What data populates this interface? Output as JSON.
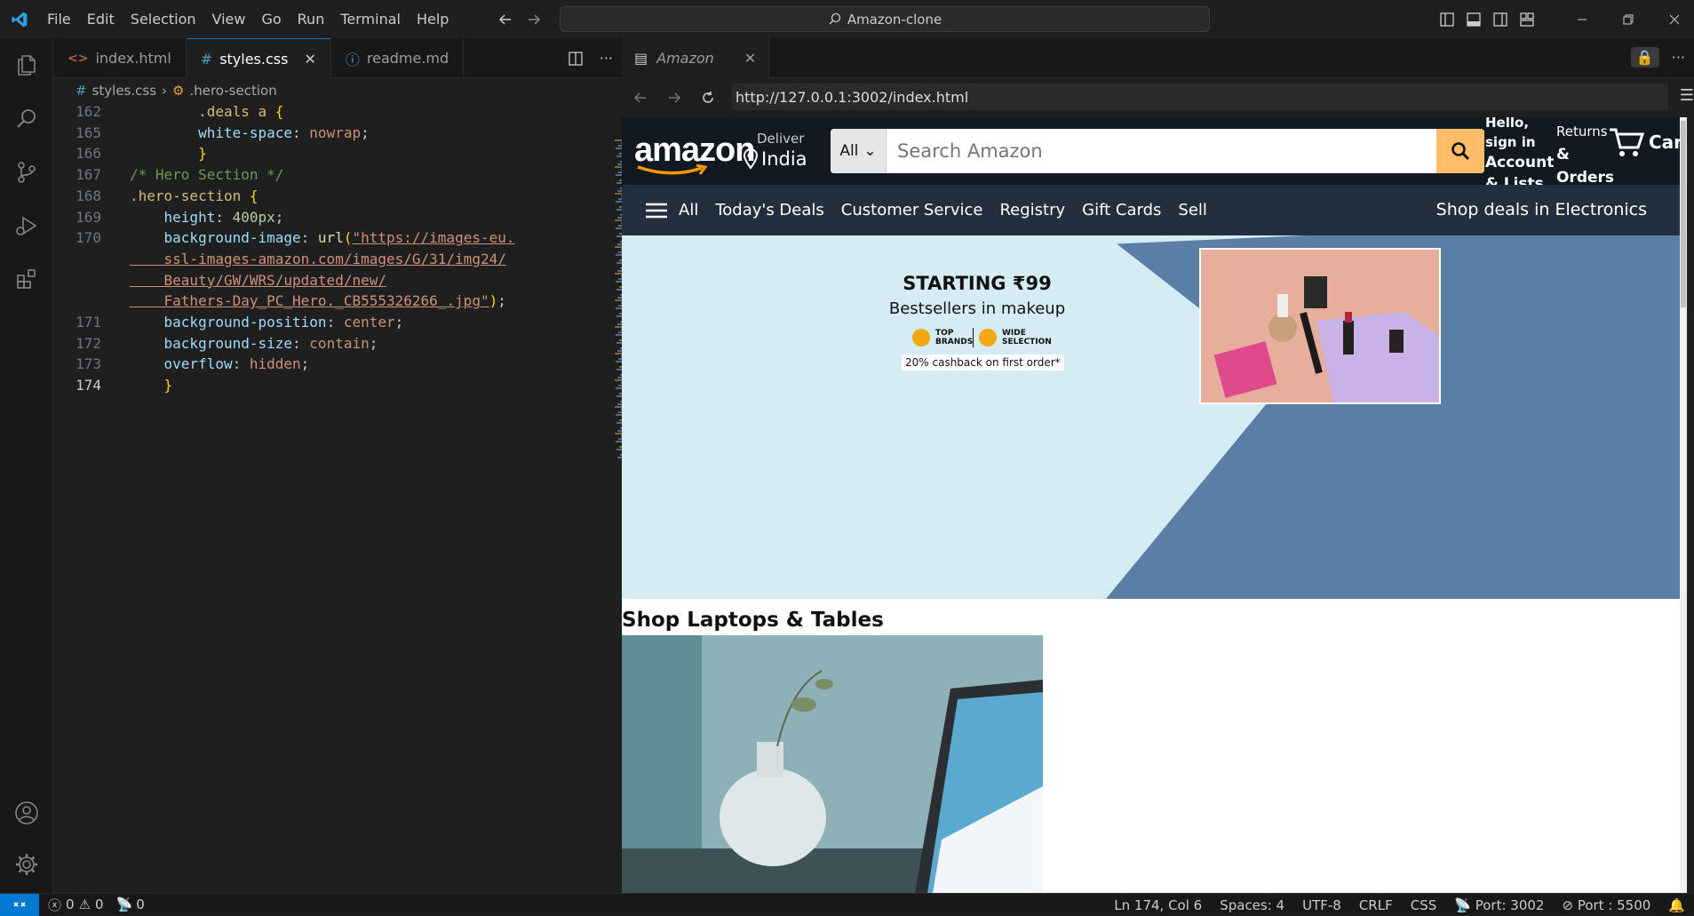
{
  "menu": [
    "File",
    "Edit",
    "Selection",
    "View",
    "Go",
    "Run",
    "Terminal",
    "Help"
  ],
  "search_title": "Amazon-clone",
  "editor": {
    "tabs": [
      {
        "label": "index.html",
        "icon": "html-icon"
      },
      {
        "label": "styles.css",
        "icon": "css-hash-icon"
      },
      {
        "label": "readme.md",
        "icon": "info-icon"
      }
    ],
    "breadcrumb": {
      "file": "styles.css",
      "symbol": ".hero-section"
    },
    "line_numbers": [
      "162",
      "165",
      "166",
      "167",
      "168",
      "169",
      "170",
      "",
      "",
      "",
      "171",
      "172",
      "173",
      "174"
    ],
    "lines": [
      {
        "parts": [
          [
            "sel",
            "        .deals a "
          ],
          [
            "br",
            "{"
          ]
        ]
      },
      {
        "parts": [
          [
            "prop",
            "        white-space"
          ],
          [
            "txt",
            ": "
          ],
          [
            "val",
            "nowrap"
          ],
          [
            "txt",
            ";"
          ]
        ]
      },
      {
        "parts": [
          [
            "br",
            "        }"
          ]
        ]
      },
      {
        "parts": [
          [
            "cmt",
            "/* Hero Section */"
          ]
        ]
      },
      {
        "parts": [
          [
            "sel",
            ".hero-section "
          ],
          [
            "br",
            "{"
          ]
        ]
      },
      {
        "parts": [
          [
            "prop",
            "    height"
          ],
          [
            "txt",
            ": "
          ],
          [
            "num",
            "400px"
          ],
          [
            "txt",
            ";"
          ]
        ]
      },
      {
        "parts": [
          [
            "prop",
            "    background-image"
          ],
          [
            "txt",
            ": "
          ],
          [
            "fn",
            "url"
          ],
          [
            "br",
            "("
          ],
          [
            "url",
            "\"https://images-eu."
          ]
        ]
      },
      {
        "parts": [
          [
            "url",
            "    ssl-images-amazon.com/images/G/31/img24/"
          ]
        ]
      },
      {
        "parts": [
          [
            "url",
            "    Beauty/GW/WRS/updated/new/"
          ]
        ]
      },
      {
        "parts": [
          [
            "url",
            "    Fathers-Day_PC_Hero._CB555326266_.jpg\""
          ],
          [
            "br",
            ")"
          ],
          [
            "txt",
            ";"
          ]
        ]
      },
      {
        "parts": [
          [
            "prop",
            "    background-position"
          ],
          [
            "txt",
            ": "
          ],
          [
            "val",
            "center"
          ],
          [
            "txt",
            ";"
          ]
        ]
      },
      {
        "parts": [
          [
            "prop",
            "    background-size"
          ],
          [
            "txt",
            ": "
          ],
          [
            "val",
            "contain"
          ],
          [
            "txt",
            ";"
          ]
        ]
      },
      {
        "parts": [
          [
            "prop",
            "    overflow"
          ],
          [
            "txt",
            ": "
          ],
          [
            "val",
            "hidden"
          ],
          [
            "txt",
            ";"
          ]
        ]
      },
      {
        "parts": [
          [
            "br",
            "    }"
          ]
        ]
      }
    ]
  },
  "browser": {
    "tab_label": "Amazon",
    "url": "http://127.0.0.1:3002/index.html"
  },
  "amazon": {
    "logo": "amazon",
    "deliver": "Deliver",
    "location": "India",
    "search_category": "All",
    "search_placeholder": "Search Amazon",
    "account_l1": "Hello, sign in",
    "account_l2": "Account & Lists",
    "returns_l1": "Returns",
    "returns_l2": "& Orders",
    "cart": "Cart",
    "nav": [
      "All",
      "Today's Deals",
      "Customer Service",
      "Registry",
      "Gift Cards",
      "Sell"
    ],
    "nav_right": "Shop deals in Electronics",
    "hero_line1": "STARTING ₹99",
    "hero_line2": "Bestsellers in makeup",
    "badge1": "TOP BRANDS",
    "badge2": "WIDE SELECTION",
    "cashback": "20% cashback on first order*",
    "section_title": "Shop Laptops & Tables"
  },
  "status": {
    "errors": "0",
    "warnings": "0",
    "ports_fwd": "0",
    "position": "Ln 174, Col 6",
    "spaces": "Spaces: 4",
    "encoding": "UTF-8",
    "eol": "CRLF",
    "language": "CSS",
    "port1": "Port: 3002",
    "port2": "Port : 5500"
  },
  "colors": {
    "accent": "#0078d4",
    "amazon_dark": "#131921",
    "amazon_nav": "#232f3e",
    "search_btn": "#febd69"
  }
}
